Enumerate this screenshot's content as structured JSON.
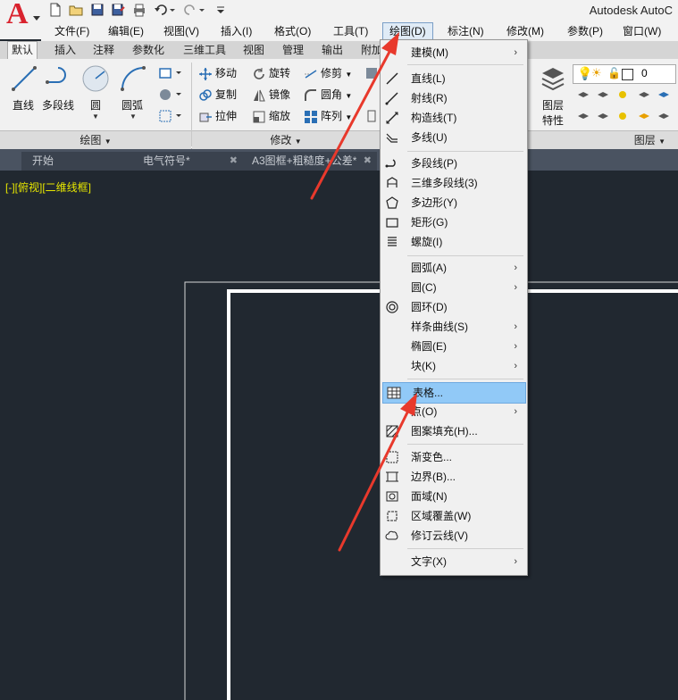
{
  "app": {
    "title": "Autodesk AutoC",
    "logo_letter": "A"
  },
  "menubar": {
    "items": [
      {
        "label": "文件(F)"
      },
      {
        "label": "编辑(E)"
      },
      {
        "label": "视图(V)"
      },
      {
        "label": "插入(I)"
      },
      {
        "label": "格式(O)"
      },
      {
        "label": "工具(T)"
      },
      {
        "label": "绘图(D)"
      },
      {
        "label": "标注(N)"
      },
      {
        "label": "修改(M)"
      },
      {
        "label": "参数(P)"
      },
      {
        "label": "窗口(W)"
      }
    ]
  },
  "ribbon_tabs": {
    "items": [
      {
        "label": "默认"
      },
      {
        "label": "插入"
      },
      {
        "label": "注释"
      },
      {
        "label": "参数化"
      },
      {
        "label": "三维工具"
      },
      {
        "label": "视图"
      },
      {
        "label": "管理"
      },
      {
        "label": "输出"
      },
      {
        "label": "附加"
      }
    ]
  },
  "ribbon": {
    "draw": {
      "line": "直线",
      "polyline": "多段线",
      "circle": "圆",
      "arc": "圆弧",
      "panel": "绘图"
    },
    "modify": {
      "move": "移动",
      "rotate": "旋转",
      "trim": "修剪",
      "copy": "复制",
      "mirror": "镜像",
      "fillet": "圆角",
      "stretch": "拉伸",
      "scale": "缩放",
      "array": "阵列",
      "panel": "修改"
    },
    "layers": {
      "properties_line1": "图层",
      "properties_line2": "特性",
      "current_layer": "0",
      "panel": "图层"
    }
  },
  "doc_tabs": {
    "items": [
      {
        "label": "开始"
      },
      {
        "label": "电气符号*"
      },
      {
        "label": "A3图框+粗糙度+公差*"
      }
    ]
  },
  "viewport": {
    "label": "[-][俯视][二维线框]"
  },
  "dropdown": {
    "items": [
      {
        "label": "建模(M)"
      },
      {
        "label": "直线(L)"
      },
      {
        "label": "射线(R)"
      },
      {
        "label": "构造线(T)"
      },
      {
        "label": "多线(U)"
      },
      {
        "label": "多段线(P)"
      },
      {
        "label": "三维多段线(3)"
      },
      {
        "label": "多边形(Y)"
      },
      {
        "label": "矩形(G)"
      },
      {
        "label": "螺旋(I)"
      },
      {
        "label": "圆弧(A)"
      },
      {
        "label": "圆(C)"
      },
      {
        "label": "圆环(D)"
      },
      {
        "label": "样条曲线(S)"
      },
      {
        "label": "椭圆(E)"
      },
      {
        "label": "块(K)"
      },
      {
        "label": "表格..."
      },
      {
        "label": "点(O)"
      },
      {
        "label": "图案填充(H)..."
      },
      {
        "label": "渐变色..."
      },
      {
        "label": "边界(B)..."
      },
      {
        "label": "面域(N)"
      },
      {
        "label": "区域覆盖(W)"
      },
      {
        "label": "修订云线(V)"
      },
      {
        "label": "文字(X)"
      }
    ],
    "submenu_arrow": "›"
  },
  "colors": {
    "canvas": "#212830",
    "highlight": "#91c9f7",
    "annotation_arrow": "#e8392c",
    "viewport_label": "#e6e600"
  }
}
